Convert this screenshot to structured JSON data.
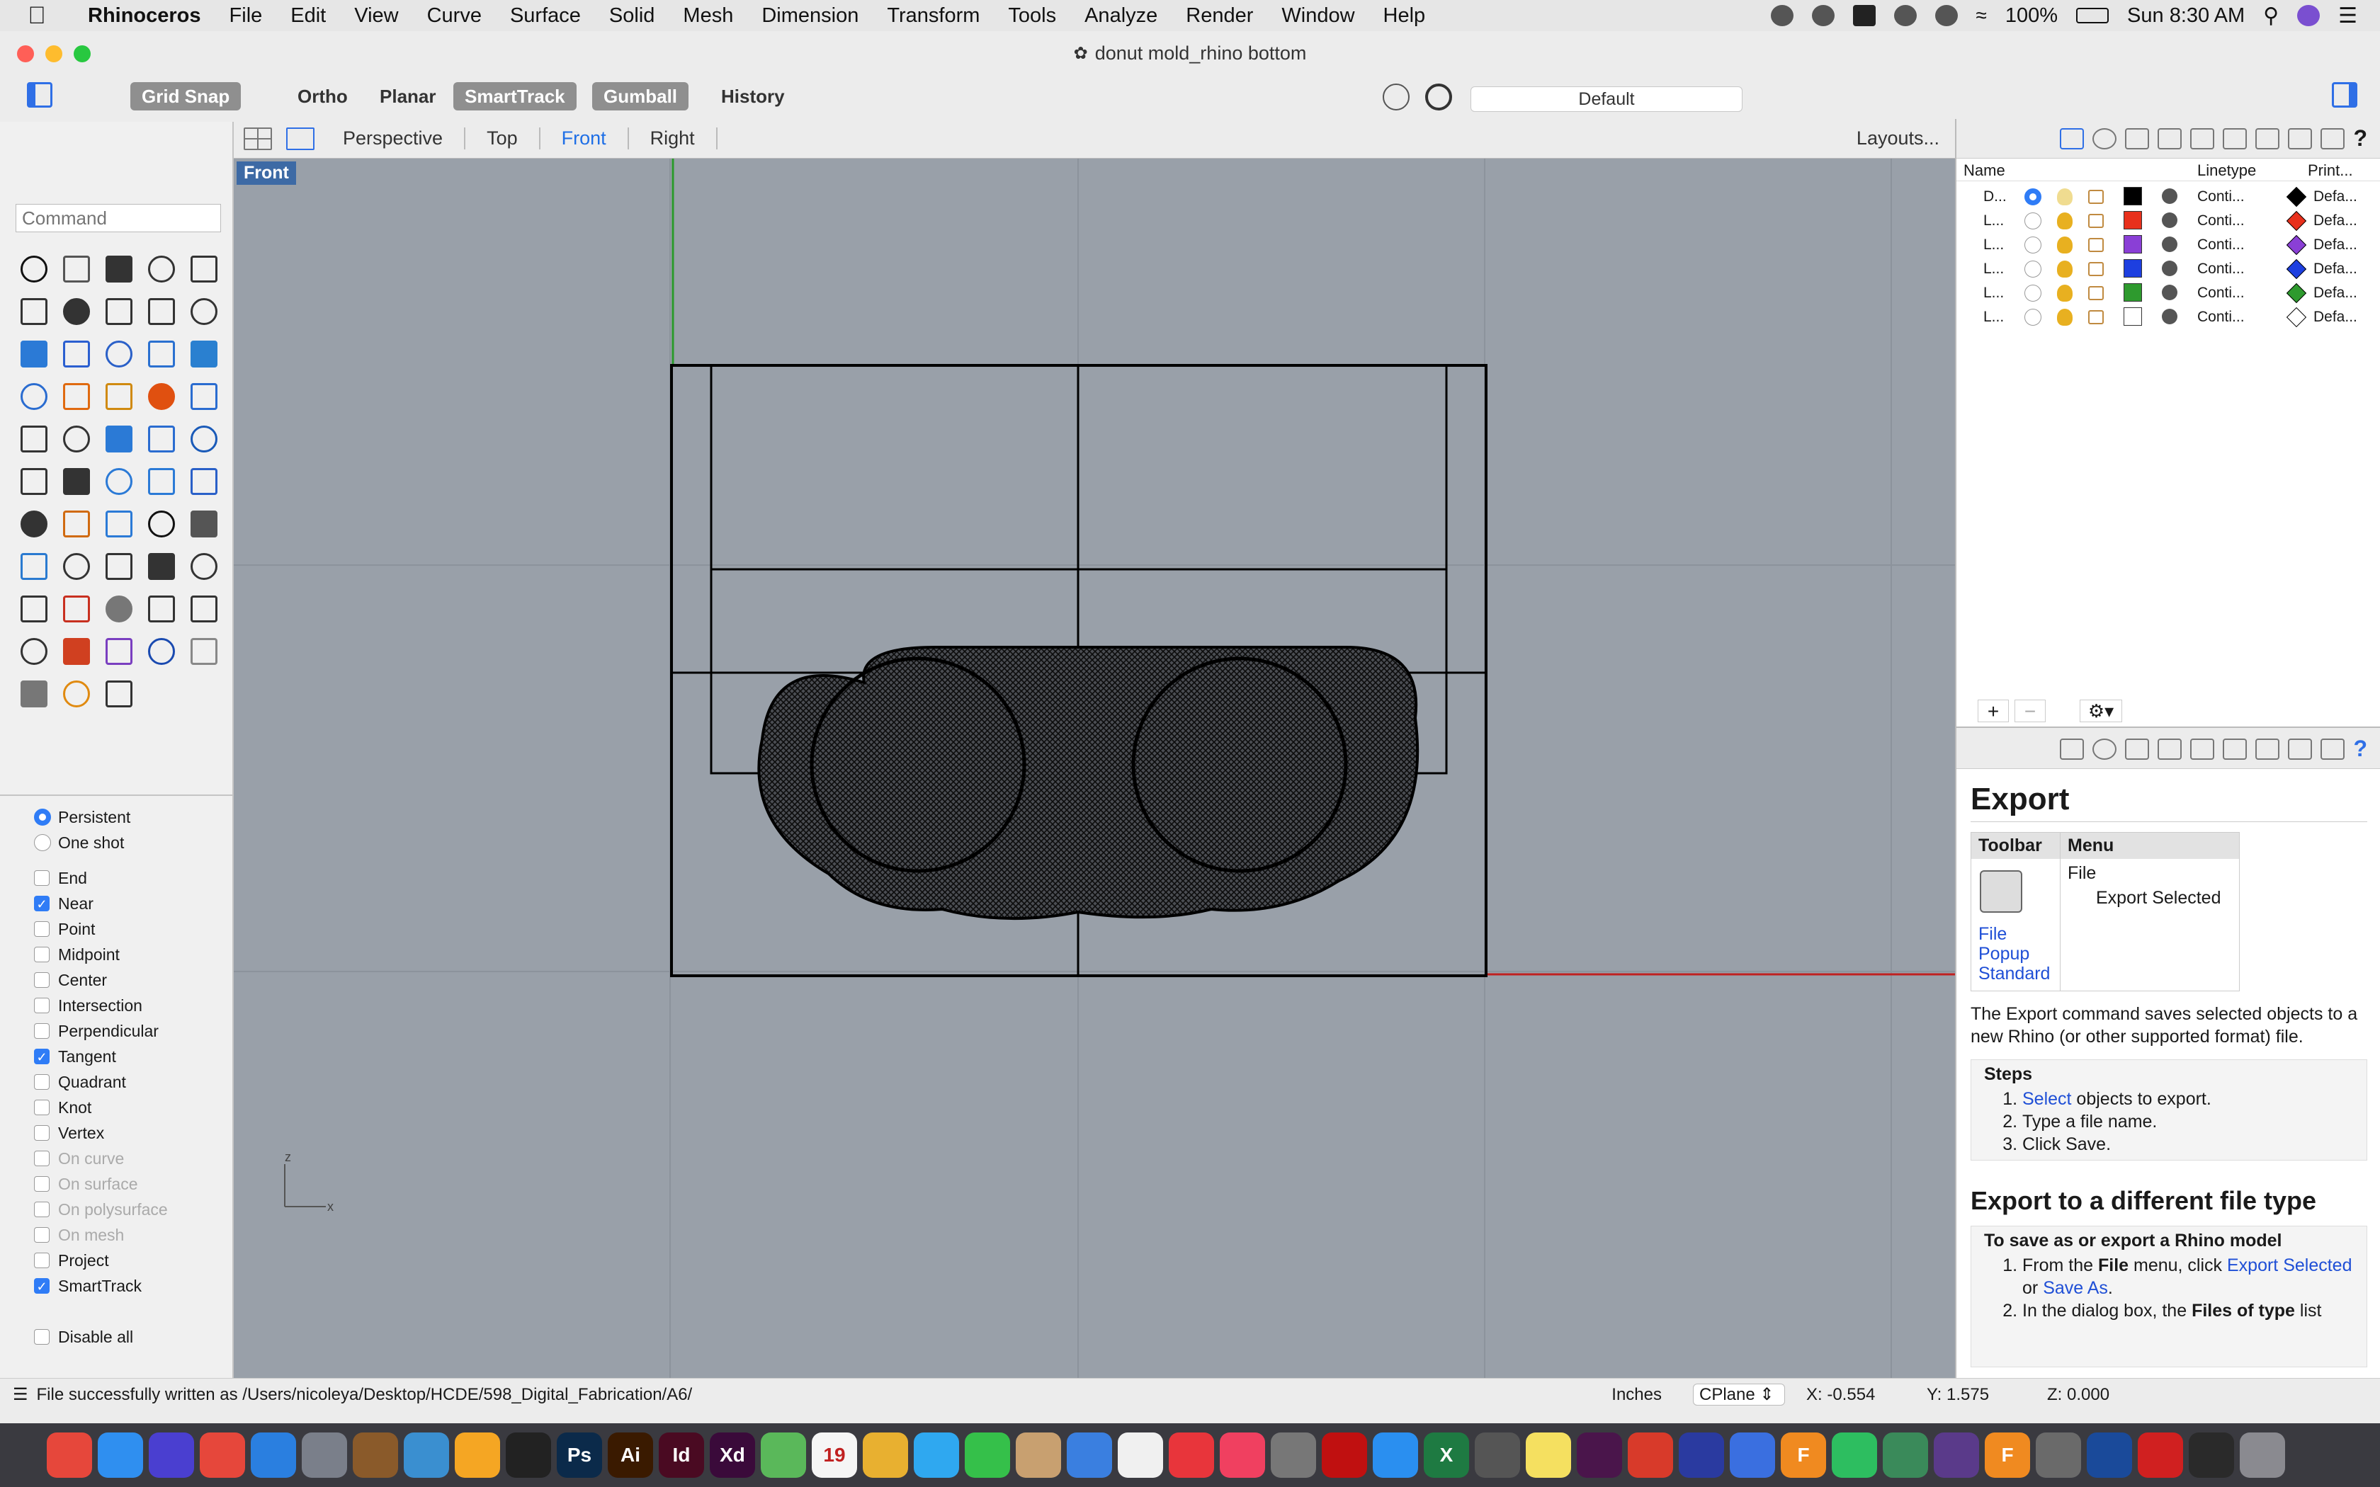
{
  "menubar": {
    "app": "Rhinoceros",
    "items": [
      "File",
      "Edit",
      "View",
      "Curve",
      "Surface",
      "Solid",
      "Mesh",
      "Dimension",
      "Transform",
      "Tools",
      "Analyze",
      "Render",
      "Window",
      "Help"
    ],
    "battery": "100%",
    "clock": "Sun 8:30 AM"
  },
  "window": {
    "title": "donut mold_rhino bottom"
  },
  "toolbar": {
    "modes": [
      {
        "label": "Grid Snap",
        "on": true
      },
      {
        "label": "Ortho",
        "on": false
      },
      {
        "label": "Planar",
        "on": false
      },
      {
        "label": "SmartTrack",
        "on": true
      },
      {
        "label": "Gumball",
        "on": true
      },
      {
        "label": "History",
        "on": false
      }
    ],
    "layer": "Default"
  },
  "command": {
    "placeholder": "Command"
  },
  "viewtabs": {
    "tabs": [
      "Perspective",
      "Top",
      "Front",
      "Right"
    ],
    "active": "Front",
    "layouts": "Layouts..."
  },
  "viewport": {
    "label": "Front",
    "axis_z": "z",
    "axis_x": "x"
  },
  "osnap": {
    "mode": [
      {
        "label": "Persistent",
        "on": true
      },
      {
        "label": "One shot",
        "on": false
      }
    ],
    "snaps": [
      {
        "label": "End",
        "on": false,
        "enabled": true
      },
      {
        "label": "Near",
        "on": true,
        "enabled": true
      },
      {
        "label": "Point",
        "on": false,
        "enabled": true
      },
      {
        "label": "Midpoint",
        "on": false,
        "enabled": true
      },
      {
        "label": "Center",
        "on": false,
        "enabled": true
      },
      {
        "label": "Intersection",
        "on": false,
        "enabled": true
      },
      {
        "label": "Perpendicular",
        "on": false,
        "enabled": true
      },
      {
        "label": "Tangent",
        "on": true,
        "enabled": true
      },
      {
        "label": "Quadrant",
        "on": false,
        "enabled": true
      },
      {
        "label": "Knot",
        "on": false,
        "enabled": true
      },
      {
        "label": "Vertex",
        "on": false,
        "enabled": true
      },
      {
        "label": "On curve",
        "on": false,
        "enabled": false
      },
      {
        "label": "On surface",
        "on": false,
        "enabled": false
      },
      {
        "label": "On polysurface",
        "on": false,
        "enabled": false
      },
      {
        "label": "On mesh",
        "on": false,
        "enabled": false
      },
      {
        "label": "Project",
        "on": false,
        "enabled": true
      },
      {
        "label": "SmartTrack",
        "on": true,
        "enabled": true
      }
    ],
    "disable_all": "Disable all"
  },
  "layers": {
    "headers": {
      "name": "Name",
      "linetype": "Linetype",
      "print": "Print..."
    },
    "rows": [
      {
        "name": "D...",
        "current": true,
        "color": "#000000",
        "linetype": "Conti...",
        "print": "Defa..."
      },
      {
        "name": "L...",
        "current": false,
        "color": "#e8301c",
        "linetype": "Conti...",
        "print": "Defa..."
      },
      {
        "name": "L...",
        "current": false,
        "color": "#8a3fd6",
        "linetype": "Conti...",
        "print": "Defa..."
      },
      {
        "name": "L...",
        "current": false,
        "color": "#1d3fe0",
        "linetype": "Conti...",
        "print": "Defa..."
      },
      {
        "name": "L...",
        "current": false,
        "color": "#2e9a2e",
        "linetype": "Conti...",
        "print": "Defa..."
      },
      {
        "name": "L...",
        "current": false,
        "color": "#ffffff",
        "linetype": "Conti...",
        "print": "Defa..."
      }
    ]
  },
  "help": {
    "title": "Export",
    "table": {
      "col1": "Toolbar",
      "col2": "Menu",
      "menu_top": "File",
      "menu_sub": "Export Selected",
      "tb_link1": "File",
      "tb_link2": "Popup",
      "tb_link3": "Standard"
    },
    "intro": "The Export command saves selected objects to a new Rhino (or other supported format) file.",
    "steps_title": "Steps",
    "step1_link": "Select",
    "step1_rest": " objects to export.",
    "step2": "Type a file name.",
    "step3": "Click Save.",
    "section2": "Export to a different file type",
    "subhead": "To save as or export a Rhino model",
    "s1_a": "From the ",
    "s1_b": "File",
    "s1_c": " menu, click ",
    "s1_link1": "Export Selected",
    "s1_or": " or ",
    "s1_link2": "Save As",
    "s1_end": ".",
    "s2_a": "In the dialog box, the ",
    "s2_b": "Files of type",
    "s2_c": " list"
  },
  "status": {
    "message": "File successfully written as /Users/nicoleya/Desktop/HCDE/598_Digital_Fabrication/A6/",
    "units": "Inches",
    "cplane": "CPlane",
    "x": "X: -0.554",
    "y": "Y: 1.575",
    "z": "Z: 0.000"
  },
  "dock": {
    "apps": [
      {
        "name": "chrome",
        "text": "",
        "color": "#e6473b"
      },
      {
        "name": "finder",
        "text": "",
        "color": "#2f8ff0"
      },
      {
        "name": "siri",
        "text": "",
        "color": "#4a3fd0"
      },
      {
        "name": "chrome-2",
        "text": "",
        "color": "#e6473b"
      },
      {
        "name": "safari",
        "text": "",
        "color": "#2a7fe0"
      },
      {
        "name": "launchpad",
        "text": "",
        "color": "#7a7f8a"
      },
      {
        "name": "notefile",
        "text": "",
        "color": "#8a5a2a"
      },
      {
        "name": "preview",
        "text": "",
        "color": "#3a8fd0"
      },
      {
        "name": "sketch",
        "text": "",
        "color": "#f5a623"
      },
      {
        "name": "figma",
        "text": "",
        "color": "#222"
      },
      {
        "name": "photoshop",
        "text": "Ps",
        "color": "#0b2a4a"
      },
      {
        "name": "illustrator",
        "text": "Ai",
        "color": "#3a1a00"
      },
      {
        "name": "indesign",
        "text": "Id",
        "color": "#4a0a22"
      },
      {
        "name": "xd",
        "text": "Xd",
        "color": "#3a0a3a"
      },
      {
        "name": "maps",
        "text": "",
        "color": "#5ab85a"
      },
      {
        "name": "calendar",
        "text": "19",
        "color": "#f5f5f5"
      },
      {
        "name": "photos",
        "text": "",
        "color": "#e8b030"
      },
      {
        "name": "messages",
        "text": "",
        "color": "#2fa8f0"
      },
      {
        "name": "facetime",
        "text": "",
        "color": "#35c04a"
      },
      {
        "name": "contacts",
        "text": "",
        "color": "#c8a070"
      },
      {
        "name": "keynote",
        "text": "",
        "color": "#3a7fe0"
      },
      {
        "name": "reminders",
        "text": "",
        "color": "#f0f0f0"
      },
      {
        "name": "news",
        "text": "",
        "color": "#e8353b"
      },
      {
        "name": "music",
        "text": "",
        "color": "#f04060"
      },
      {
        "name": "system-prefs",
        "text": "",
        "color": "#777"
      },
      {
        "name": "acrobat",
        "text": "",
        "color": "#c01010"
      },
      {
        "name": "app-store",
        "text": "",
        "color": "#2a8ff0"
      },
      {
        "name": "excel",
        "text": "X",
        "color": "#1e7a42"
      },
      {
        "name": "notes-app",
        "text": "",
        "color": "#555"
      },
      {
        "name": "stickies",
        "text": "",
        "color": "#f5e060"
      },
      {
        "name": "slack",
        "text": "",
        "color": "#4a154b"
      },
      {
        "name": "wunderlist",
        "text": "",
        "color": "#d83a2a"
      },
      {
        "name": "pandora",
        "text": "",
        "color": "#2a3aa0"
      },
      {
        "name": "artstudio",
        "text": "",
        "color": "#3a6fe0"
      },
      {
        "name": "fusion",
        "text": "F",
        "color": "#f08a20"
      },
      {
        "name": "evernote",
        "text": "",
        "color": "#2dbe60"
      },
      {
        "name": "atom",
        "text": "",
        "color": "#3a8a5a"
      },
      {
        "name": "github",
        "text": "",
        "color": "#5a3a8a"
      },
      {
        "name": "fusion-2",
        "text": "F",
        "color": "#f08a20"
      },
      {
        "name": "rhino",
        "text": "",
        "color": "#6a6a6a"
      },
      {
        "name": "sourcetree",
        "text": "",
        "color": "#1a4a9a"
      },
      {
        "name": "red-app",
        "text": "",
        "color": "#d02020"
      },
      {
        "name": "terminal",
        "text": "",
        "color": "#2a2a2a"
      },
      {
        "name": "trash",
        "text": "",
        "color": "#8a8a90"
      }
    ]
  }
}
